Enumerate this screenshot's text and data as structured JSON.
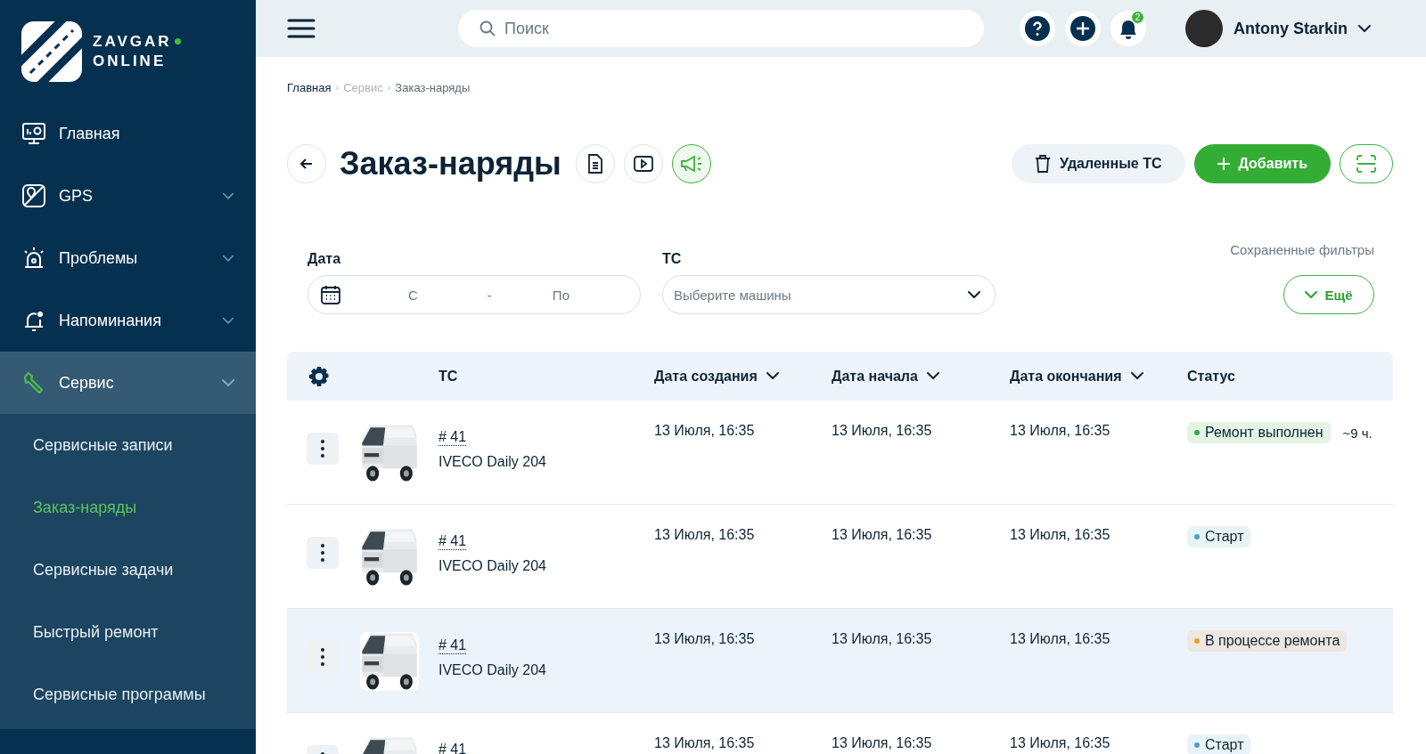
{
  "sidebar": {
    "logo": {
      "line_1": "ZAVGAR",
      "line_2": "ONLINE"
    },
    "items": [
      {
        "label": "Главная",
        "kind": "link",
        "selected": false
      },
      {
        "label": "GPS",
        "kind": "group",
        "selected": false,
        "expanded": false
      },
      {
        "label": "Проблемы",
        "kind": "group",
        "selected": false,
        "expanded": false
      },
      {
        "label": "Напоминания",
        "kind": "group",
        "selected": false,
        "expanded": false
      },
      {
        "label": "Сервис",
        "kind": "group",
        "selected": true,
        "expanded": true,
        "children": [
          {
            "label": "Сервисные записи",
            "selected": false
          },
          {
            "label": "Заказ-наряды",
            "selected": true
          },
          {
            "label": "Сервисные задачи",
            "selected": false
          },
          {
            "label": "Быстрый ремонт",
            "selected": false
          },
          {
            "label": "Сервисные программы",
            "selected": false
          }
        ]
      }
    ]
  },
  "topbar": {
    "search": {
      "placeholder": "Поиск"
    },
    "notifications_badge": "2",
    "user": {
      "name": "Antony Starkin"
    }
  },
  "breadcrumb": [
    {
      "label": "Главная"
    },
    {
      "separator": "›",
      "label": "Сервис"
    },
    {
      "separator": "›",
      "label": "Заказ-наряды"
    }
  ],
  "header": {
    "title": "Заказ-наряды",
    "deleted_button": "Удаленные ТС",
    "add_button": "Добавить"
  },
  "filters": {
    "date": {
      "label": "Дата",
      "from_placeholder": "С",
      "separator": "-",
      "to_placeholder": "По"
    },
    "vehicle": {
      "label": "ТС",
      "placeholder": "Выберите машины"
    },
    "saved_filters_label": "Сохраненные фильтры",
    "more_button": "Ещё"
  },
  "table": {
    "columns": [
      {
        "label": "ТС",
        "sortable": false
      },
      {
        "label": "Дата создания",
        "sortable": true
      },
      {
        "label": "Дата начала",
        "sortable": true
      },
      {
        "label": "Дата окончания",
        "sortable": true
      },
      {
        "label": "Статус",
        "sortable": false
      }
    ],
    "rows": [
      {
        "selected": false,
        "number": "# 41",
        "name": "IVECO Daily 204",
        "created": "13 Июля, 16:35",
        "start": "13 Июля, 16:35",
        "end": "13 Июля, 16:35",
        "status": {
          "label": "Ремонт выполнен",
          "color": "#2eaa3c"
        },
        "duration": "~9 ч."
      },
      {
        "selected": false,
        "number": "# 41",
        "name": "IVECO Daily 204",
        "created": "13 Июля, 16:35",
        "start": "13 Июля, 16:35",
        "end": "13 Июля, 16:35",
        "status": {
          "label": "Старт",
          "color": "#4aa3c4"
        }
      },
      {
        "selected": true,
        "number": "# 41",
        "name": "IVECO Daily 204",
        "created": "13 Июля, 16:35",
        "start": "13 Июля, 16:35",
        "end": "13 Июля, 16:35",
        "status": {
          "label": "В процессе ремонта",
          "color": "#f09a30"
        }
      },
      {
        "selected": false,
        "number": "# 41",
        "created": "13 Июля, 16:35",
        "start": "13 Июля, 16:35",
        "end": "13 Июля, 16:35",
        "status": {
          "label": "Старт",
          "color": "#4aa3c4"
        }
      }
    ]
  }
}
